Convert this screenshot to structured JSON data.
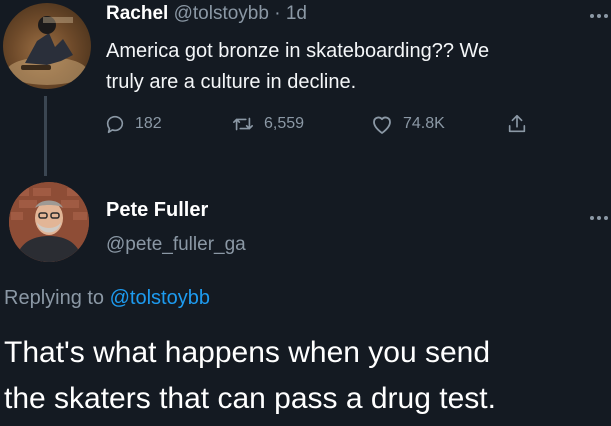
{
  "original_tweet": {
    "author_name": "Rachel",
    "author_handle": "@tolstoybb",
    "separator": "·",
    "time_ago": "1d",
    "text_line1": "America got bronze in skateboarding?? We",
    "text_line2": "truly are a culture in decline.",
    "more_icon": "more-horizontal-icon",
    "actions": {
      "reply_count": "182",
      "retweet_count": "6,559",
      "like_count": "74.8K",
      "reply_icon": "reply-icon",
      "retweet_icon": "retweet-icon",
      "like_icon": "heart-icon",
      "share_icon": "share-icon"
    }
  },
  "reply_tweet": {
    "author_name": "Pete Fuller",
    "author_handle": "@pete_fuller_ga",
    "replying_prefix": "Replying to",
    "replying_to": "@tolstoybb",
    "text_line1": "That's what happens when you send",
    "text_line2": "the skaters that can pass a drug test.",
    "more_icon": "more-horizontal-icon"
  },
  "colors": {
    "background": "#141a22",
    "muted_text": "#8b98a5",
    "link": "#1d9bf0",
    "thread_line": "#3b4652"
  }
}
